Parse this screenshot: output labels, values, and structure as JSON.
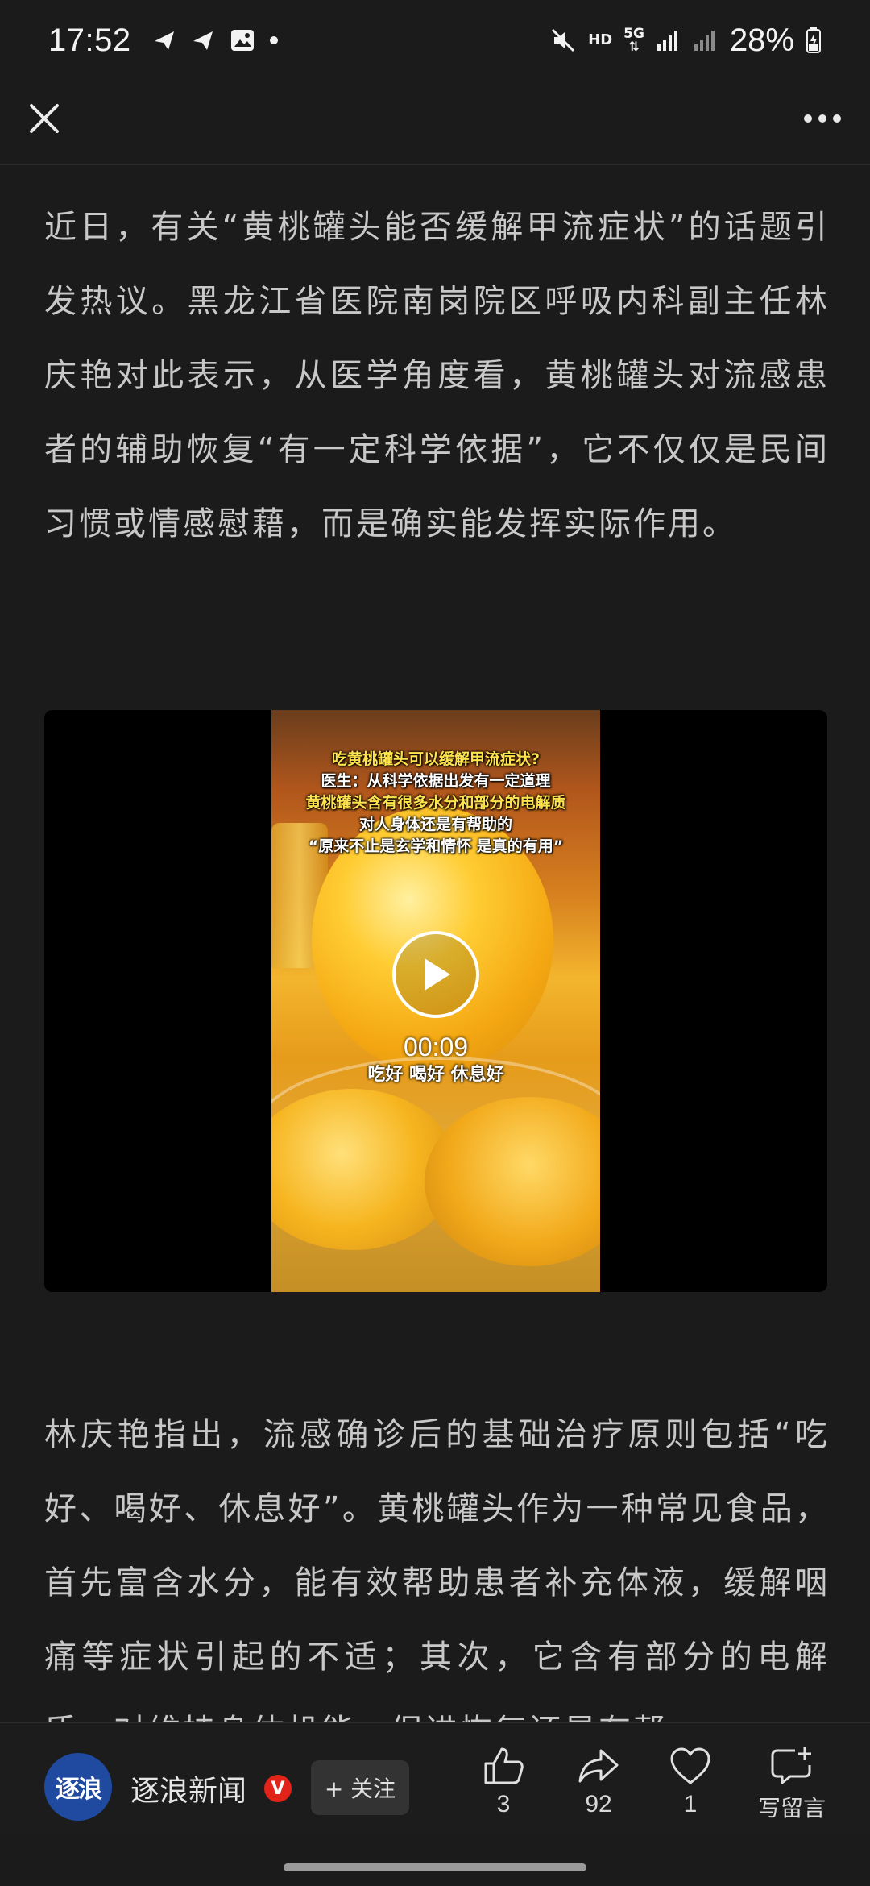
{
  "status_bar": {
    "time": "17:52",
    "network": "5G",
    "hd_label": "HD",
    "battery": "28%"
  },
  "top_bar": {
    "close_icon": "close-icon",
    "more_icon": "more-icon"
  },
  "article": {
    "paragraph_1": "近日，有关“黄桃罐头能否缓解甲流症状”的话题引发热议。黑龙江省医院南岗院区呼吸内科副主任林庆艳对此表示，从医学角度看，黄桃罐头对流感患者的辅助恢复“有一定科学依据”，它不仅仅是民间习惯或情感慰藉，而是确实能发挥实际作用。",
    "video": {
      "caption_1": "吃黄桃罐头可以缓解甲流症状?",
      "caption_2": "医生：从科学依据出发有一定道理",
      "caption_3": "黄桃罐头含有很多水分和部分的电解质",
      "caption_4": "对人身体还是有帮助的",
      "caption_5": "“原来不止是玄学和情怀 是真的有用”",
      "duration": "00:09",
      "subtitle": "吃好 喝好 休息好"
    },
    "paragraph_2": "林庆艳指出，流感确诊后的基础治疗原则包括“吃好、喝好、休息好”。黄桃罐头作为一种常见食品，首先富含水分，能有效帮助患者补充体液，缓解咽痛等症状引起的不适；其次，它含有部分的电解质，对维持身体机能、促进恢复还是有帮"
  },
  "bottom_bar": {
    "avatar_text": "逐浪",
    "source_name": "逐浪新闻",
    "verified_mark": "V",
    "follow_label": "+ 关注",
    "like_count": "3",
    "share_count": "92",
    "favorite_count": "1",
    "comment_label": "写留言"
  }
}
